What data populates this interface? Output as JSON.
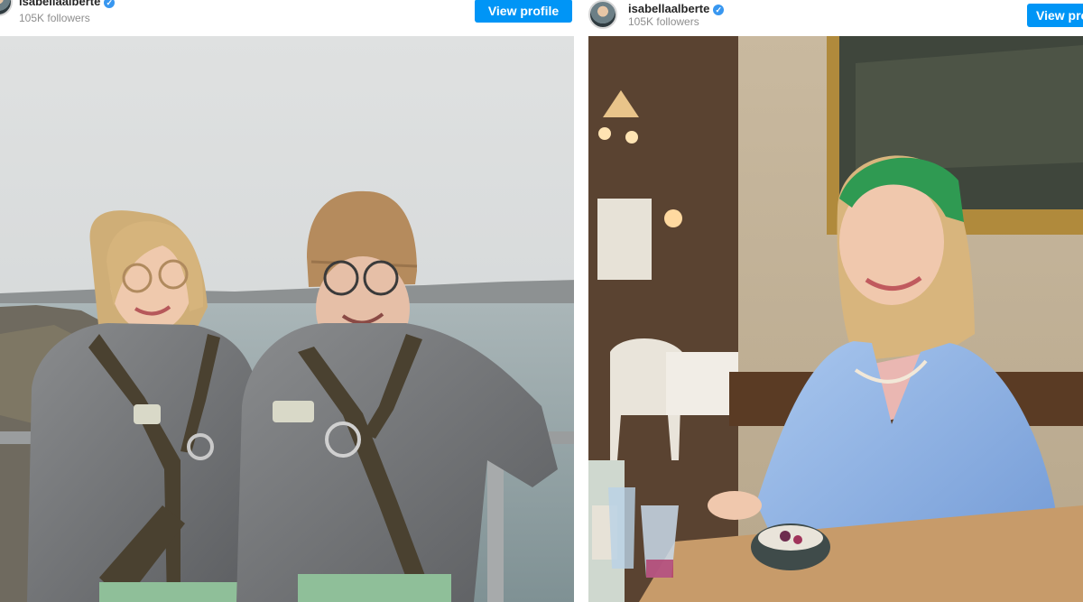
{
  "posts": [
    {
      "username": "isabellaalberte",
      "verified_icon": "verified-badge-icon",
      "followers": "105K followers",
      "view_profile": "View profile",
      "photo_subject": "two-people-in-harness-gear-photo"
    },
    {
      "username": "isabellaalberte",
      "verified_icon": "verified-badge-icon",
      "followers": "105K followers",
      "view_profile": "View profile",
      "photo_subject": "woman-at-restaurant-table-photo"
    }
  ],
  "colors": {
    "accent": "#0095f6",
    "verified": "#3897f0",
    "username": "#262626",
    "secondary_text": "#8e8e8e"
  }
}
